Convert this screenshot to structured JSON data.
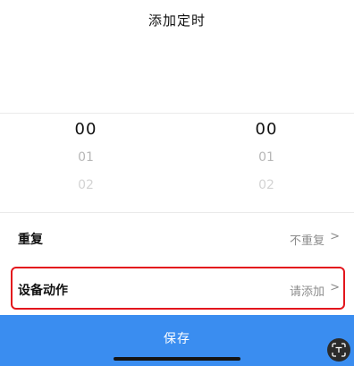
{
  "header": {
    "title": "添加定时"
  },
  "time_picker": {
    "hour": {
      "selected": "00",
      "next": [
        "01",
        "02"
      ]
    },
    "minute": {
      "selected": "00",
      "next": [
        "01",
        "02"
      ]
    }
  },
  "settings": {
    "repeat": {
      "label": "重复",
      "value": "不重复"
    },
    "device_action": {
      "label": "设备动作",
      "value": "请添加"
    }
  },
  "footer": {
    "save_label": "保存"
  },
  "colors": {
    "accent": "#3a8df0",
    "highlight_border": "#e3161d"
  },
  "icons": {
    "chevron": "chevron-right-icon",
    "scan": "scan-text-icon"
  }
}
